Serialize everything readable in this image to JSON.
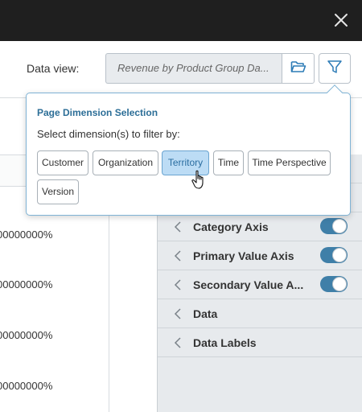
{
  "topbar": {
    "close_icon": "close-icon"
  },
  "data_view": {
    "label": "Data view:",
    "value": "Revenue by Product Group Da...",
    "folder_icon": "folder-open-icon",
    "filter_icon": "filter-icon"
  },
  "popover": {
    "title": "Page Dimension Selection",
    "subtitle": "Select dimension(s) to filter by:",
    "chips": [
      {
        "label": "Customer",
        "selected": false
      },
      {
        "label": "Organization",
        "selected": false
      },
      {
        "label": "Territory",
        "selected": true
      },
      {
        "label": "Time",
        "selected": false
      },
      {
        "label": "Time Perspective",
        "selected": false
      },
      {
        "label": "Version",
        "selected": false
      }
    ]
  },
  "table": {
    "percent_values": [
      "00000000%",
      "00000000%",
      "00000000%",
      "00000000%"
    ]
  },
  "properties": [
    {
      "label": "Category Axis",
      "toggle": true
    },
    {
      "label": "Primary Value Axis",
      "toggle": true
    },
    {
      "label": "Secondary Value A...",
      "toggle": true
    },
    {
      "label": "Data",
      "toggle": false
    },
    {
      "label": "Data Labels",
      "toggle": false
    }
  ],
  "colors": {
    "accent": "#3f7fa8",
    "selected_chip": "#bcdcf5",
    "topbar": "#1f1f1f"
  }
}
